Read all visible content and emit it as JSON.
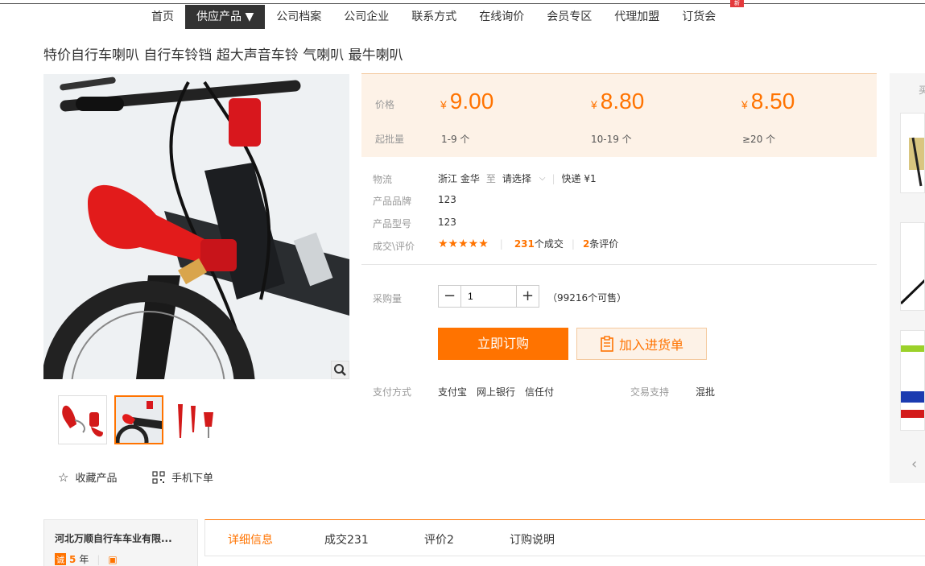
{
  "nav": {
    "items": [
      "首页",
      "供应产品 ▼",
      "公司档案",
      "公司企业",
      "联系方式",
      "在线询价",
      "会员专区",
      "代理加盟",
      "订货会"
    ],
    "badge": "新"
  },
  "product": {
    "title": "特价自行车喇叭 自行车铃铛 超大声音车铃 气喇叭 最牛喇叭"
  },
  "actions": {
    "favorite": "收藏产品",
    "mobile_order": "手机下单"
  },
  "price_box": {
    "price_label": "价格",
    "moq_label": "起批量",
    "currency": "¥",
    "tiers": [
      {
        "price": "9.00",
        "range": "1-9 个"
      },
      {
        "price": "8.80",
        "range": "10-19 个"
      },
      {
        "price": "8.50",
        "range": "≥20 个"
      }
    ]
  },
  "attrs": {
    "logistics_label": "物流",
    "origin": "浙江 金华",
    "to": "至",
    "select": "请选择",
    "express": "快递 ¥1",
    "brand_label": "产品品牌",
    "brand": "123",
    "model_label": "产品型号",
    "model": "123",
    "review_label": "成交\\评价",
    "stars": "★★★★★",
    "deals_count": "231",
    "deals_text": "个成交",
    "reviews_count": "2",
    "reviews_text": "条评价"
  },
  "purchase": {
    "qty_label": "采购量",
    "qty_value": "1",
    "minus": "−",
    "plus": "+",
    "stock": "（99216个可售）",
    "buy_now": "立即订购",
    "add_cart": "加入进货单"
  },
  "payment": {
    "label": "支付方式",
    "methods": "支付宝　网上银行　信任付",
    "support_label": "交易支持",
    "support": "混批"
  },
  "side": {
    "title": "买"
  },
  "company": {
    "name": "河北万顺自行车车业有限...",
    "years_badge": "诚",
    "years": "5",
    "years_unit": "年"
  },
  "tabs": [
    "详细信息",
    "成交231",
    "评价2",
    "订购说明"
  ],
  "colors": {
    "accent": "#ff7300",
    "price_bg": "#fdf2e7",
    "nav_active": "#333333"
  }
}
